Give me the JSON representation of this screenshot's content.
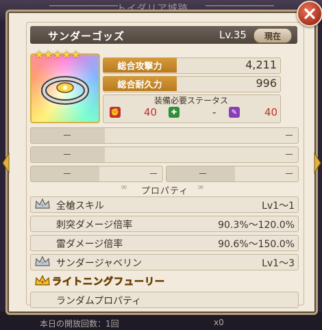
{
  "background": {
    "title": "トイダリア城跡",
    "footer_left": "本日の開放回数：1回",
    "footer_right": "x0"
  },
  "item": {
    "name": "サンダーゴッズ",
    "level": "Lv.35",
    "current_label": "現在",
    "stars": "★★★★★"
  },
  "stats": {
    "attack_label": "総合攻撃力",
    "attack_value": "4,211",
    "durability_label": "総合耐久力",
    "durability_value": "996"
  },
  "requirements": {
    "title": "装備必要ステータス",
    "items": [
      {
        "icon": "fire-fist-icon",
        "color": "#c0322a",
        "value": "40"
      },
      {
        "icon": "green-plus-icon",
        "color": "#2f8f3a",
        "value": "-"
      },
      {
        "icon": "purple-wand-icon",
        "color": "#8a3fb8",
        "value": "40"
      }
    ]
  },
  "slots": {
    "dash": "－"
  },
  "properties": {
    "divider_label": "プロパティ",
    "rows": [
      {
        "label": "全槍スキル",
        "value": "Lv1～1",
        "crown": "silver"
      },
      {
        "label": "刺突ダメージ倍率",
        "value": "90.3%～120.0%"
      },
      {
        "label": "雷ダメージ倍率",
        "value": "90.6%～150.0%"
      },
      {
        "label": "サンダージャベリン",
        "value": "Lv1～3",
        "crown": "silver"
      },
      {
        "label": "ライトニングフューリー",
        "crown": "gold"
      },
      {
        "label": "ランダムプロパティ"
      }
    ]
  },
  "colors": {
    "accent": "#d59a3a",
    "req_value": "#c0322a",
    "gold_text": "#f2c21e"
  }
}
